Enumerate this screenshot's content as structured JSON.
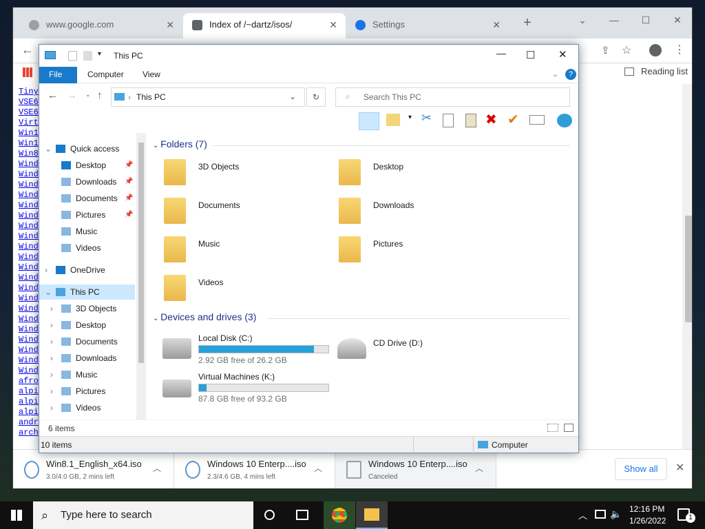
{
  "browser": {
    "tabs": [
      {
        "label": "www.google.com",
        "active": false
      },
      {
        "label": "Index of /~dartz/isos/",
        "active": true
      },
      {
        "label": "Settings",
        "active": false
      }
    ],
    "reading_list": "Reading list",
    "page_links": [
      "Tiny",
      "VSE6",
      "VSE6",
      "Virt",
      "Win1",
      "Win1",
      "Win8",
      "Wind",
      "Wind",
      "Wind",
      "Wind",
      "Wind",
      "Wind",
      "Wind",
      "Wind",
      "Wind",
      "Wind",
      "Wind",
      "Wind",
      "Wind",
      "Wind",
      "Wind",
      "Wind",
      "Wind",
      "Wind",
      "Wind",
      "Wind",
      "Wind",
      "afro",
      "alpi",
      "alpi",
      "alpi",
      "andr",
      "arch"
    ],
    "downloads": [
      {
        "name": "Win8.1_English_x64.iso",
        "status": "3.0/4.0 GB, 2 mins left"
      },
      {
        "name": "Windows 10 Enterp....iso",
        "status": "2.3/4.6 GB, 4 mins left"
      },
      {
        "name": "Windows 10 Enterp....iso",
        "status": "Canceled"
      }
    ],
    "show_all": "Show all"
  },
  "explorer": {
    "title": "This PC",
    "ribbon_tabs": [
      "File",
      "Computer",
      "View"
    ],
    "address": "This PC",
    "search_placeholder": "Search This PC",
    "nav": {
      "quick_access": "Quick access",
      "quick_items": [
        "Desktop",
        "Downloads",
        "Documents",
        "Pictures",
        "Music",
        "Videos"
      ],
      "onedrive": "OneDrive",
      "this_pc": "This PC",
      "pc_items": [
        "3D Objects",
        "Desktop",
        "Documents",
        "Downloads",
        "Music",
        "Pictures",
        "Videos"
      ]
    },
    "folders_header": "Folders (7)",
    "folders": [
      "3D Objects",
      "Desktop",
      "Documents",
      "Downloads",
      "Music",
      "Pictures",
      "Videos"
    ],
    "devices_header": "Devices and drives (3)",
    "drives": [
      {
        "name": "Local Disk (C:)",
        "free": "2.92 GB free of 26.2 GB",
        "used_fraction": 0.89
      },
      {
        "name": "CD Drive (D:)"
      },
      {
        "name": "Virtual Machines (K:)",
        "free": "87.8 GB free of 93.2 GB",
        "used_fraction": 0.06
      }
    ],
    "status_items_inner": "6 items",
    "status_items": "10 items",
    "status_location": "Computer"
  },
  "taskbar": {
    "search_placeholder": "Type here to search",
    "time": "12:16 PM",
    "date": "1/26/2022",
    "notification_count": "1"
  },
  "colors": {
    "accent": "#1979ca",
    "drive_fill": "#26a0da",
    "folder": "#f8d775"
  }
}
